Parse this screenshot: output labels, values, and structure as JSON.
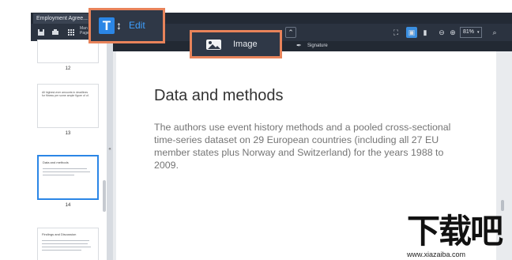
{
  "tab": {
    "title": "Employment Agree...",
    "close": "✕"
  },
  "toolbar": {
    "manage_pages_label_1": "Man",
    "manage_pages_label_2": "Page",
    "zoom": "81%",
    "signature_label": "Signature"
  },
  "callouts": {
    "edit_label": "Edit",
    "edit_icon_glyph": "T",
    "image_label": "Image"
  },
  "sidebar": {
    "pages": [
      {
        "number": "12"
      },
      {
        "number": "13",
        "text": "All highest-ever amounts in deadlines for fitness per some ample figure of of."
      },
      {
        "number": "14",
        "heading": "Data and methods",
        "active": true
      },
      {
        "number": "",
        "heading": "Findings and Discussion"
      }
    ]
  },
  "document": {
    "heading": "Data and methods",
    "paragraph": "The authors use event history methods and a pooled cross-sectional time-series dataset on 29 European countries (including all 27 EU member states plus Norway and Switzerland) for the years 1988 to 2009."
  },
  "watermark": {
    "text": "下载吧",
    "url": "www.xiazaiba.com"
  },
  "colors": {
    "accent": "#2b86e6",
    "callout_border": "#e8835a",
    "frame": "#2b3340"
  }
}
